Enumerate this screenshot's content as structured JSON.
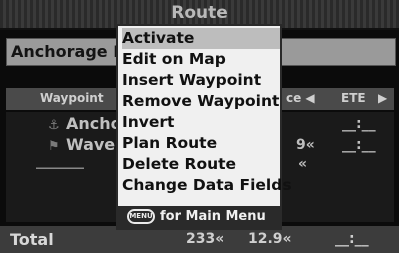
{
  "title": "Route",
  "route_name": "Anchorage B",
  "columns": {
    "waypoint": "Waypoint",
    "distance": "ce ◀",
    "ete": "ETE",
    "right_arrow": "▶"
  },
  "waypoints": [
    {
      "name": "Ancho",
      "flag": "⚓",
      "distance": "",
      "ete": "__:__"
    },
    {
      "name": "Waver",
      "flag": "⚑",
      "distance": "9«",
      "ete": "__:__"
    },
    {
      "name": "______",
      "flag": "",
      "distance": "«",
      "ete": ""
    }
  ],
  "menu": {
    "items": [
      "Activate",
      "Edit on Map",
      "Insert Waypoint",
      "Remove Waypoint",
      "Invert",
      "Plan Route",
      "Delete Route",
      "Change Data Fields"
    ],
    "selected_index": 0,
    "button_label": "MENU",
    "footer_text": "for Main Menu"
  },
  "footer": {
    "label": "Total",
    "distance": "233«",
    "distance2": "12.9«",
    "ete": "__:__"
  },
  "colors": {
    "menu_bg": "#f0f0f0",
    "selection": "#bdbdbd",
    "screen_bg": "#0b0b0b"
  }
}
